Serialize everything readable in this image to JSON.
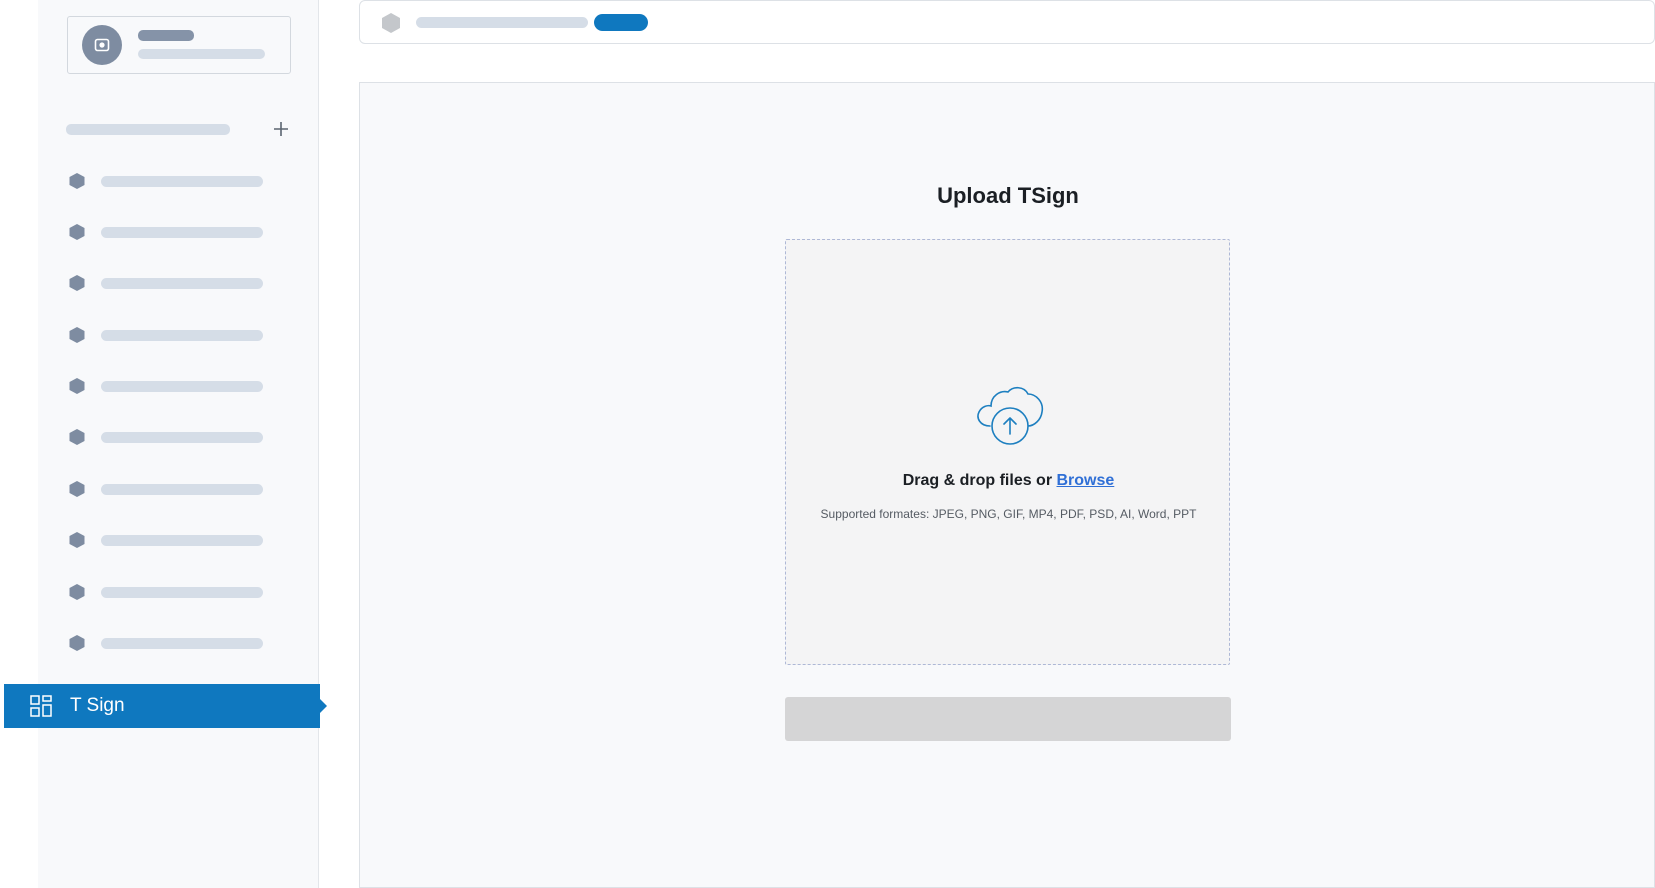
{
  "sidebar": {
    "add_icon": "plus-icon",
    "nav_items_count_label": "",
    "active_item": {
      "label": "T Sign",
      "icon": "grid-icon"
    }
  },
  "upload": {
    "title": "Upload TSign",
    "drop_prefix": "Drag & drop files or ",
    "browse_label": "Browse",
    "formats": "Supported formates: JPEG, PNG, GIF, MP4, PDF, PSD, AI, Word, PPT",
    "cloud_icon": "cloud-upload-icon"
  },
  "colors": {
    "accent": "#0f78bf",
    "link": "#2f6fd6",
    "skeleton": "#d5dde7",
    "skeleton_dark": "#8593a8",
    "disabled_button": "#d5d5d6"
  }
}
